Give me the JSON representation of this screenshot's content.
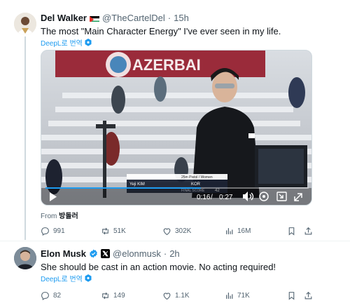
{
  "tweet1": {
    "name": "Del Walker",
    "handle": "@TheCartelDel",
    "time": "15h",
    "sep": "·",
    "text": "The most \"Main Character Energy\" I've ever seen in my life.",
    "translate": "DeepL로 번역",
    "video": {
      "banner_text": "AZERBAI",
      "caption_event": "25m Pistol / Women",
      "caption_name": "Yeji KIM",
      "caption_final": "FINAL SCORE",
      "caption_score": "42",
      "caption_code": "KOR",
      "time_current": "0:16",
      "time_total": "0:27",
      "time_sep": " / ",
      "progress": 0.59
    },
    "from_label": "From",
    "from_name": "방돌러",
    "stats": {
      "replies": "991",
      "retweets": "51K",
      "likes": "302K",
      "views": "16M"
    }
  },
  "tweet2": {
    "name": "Elon Musk",
    "handle": "@elonmusk",
    "time": "2h",
    "sep": "·",
    "text": "She should be cast in an action movie. No  acting required!",
    "translate": "DeepL로 번역",
    "stats": {
      "replies": "82",
      "retweets": "149",
      "likes": "1.1K",
      "views": "71K"
    }
  },
  "colors": {
    "accent": "#1d9bf0",
    "muted": "#536471",
    "verified": "#1d9bf0"
  },
  "icons": [
    "reply-icon",
    "retweet-icon",
    "like-icon",
    "views-icon",
    "bookmark-icon",
    "share-icon",
    "play-icon",
    "volume-icon",
    "settings-icon",
    "fullscreen-icon",
    "verified-badge-icon",
    "x-affiliate-icon",
    "deepl-icon"
  ]
}
